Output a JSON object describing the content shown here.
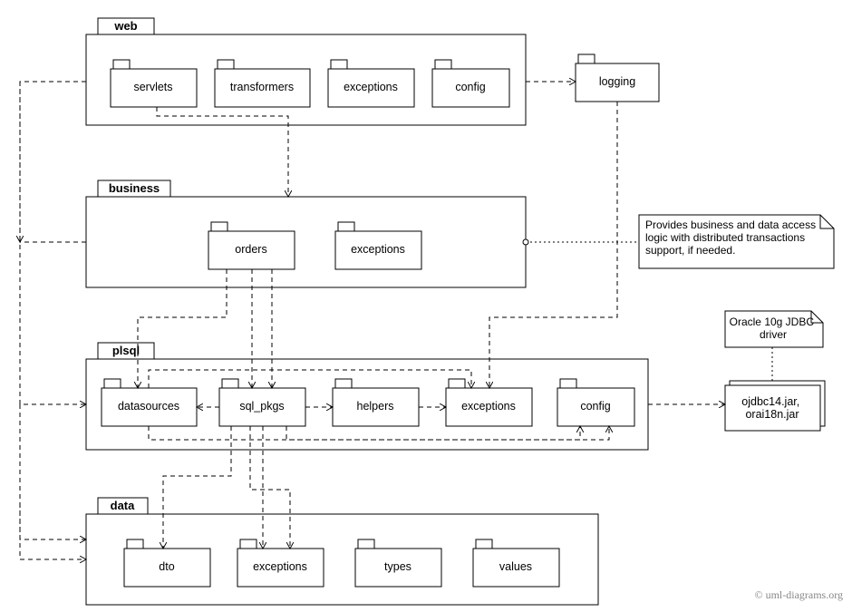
{
  "packages": {
    "web": {
      "label": "web",
      "children": {
        "servlets": "servlets",
        "transformers": "transformers",
        "exceptions": "exceptions",
        "config": "config"
      }
    },
    "business": {
      "label": "business",
      "children": {
        "orders": "orders",
        "exceptions": "exceptions"
      }
    },
    "plsql": {
      "label": "plsql",
      "children": {
        "datasources": "datasources",
        "sql_pkgs": "sql_pkgs",
        "helpers": "helpers",
        "exceptions": "exceptions",
        "config": "config"
      }
    },
    "data": {
      "label": "data",
      "children": {
        "dto": "dto",
        "exceptions": "exceptions",
        "types": "types",
        "values": "values"
      }
    },
    "logging": {
      "label": "logging"
    },
    "jdbc": {
      "label": "ojdbc14.jar,\norai18n.jar"
    }
  },
  "notes": {
    "business_note": "Provides business and data access logic with distributed transactions support, if needed.",
    "jdbc_note": "Oracle 10g JDBC driver"
  },
  "footer": "© uml-diagrams.org"
}
